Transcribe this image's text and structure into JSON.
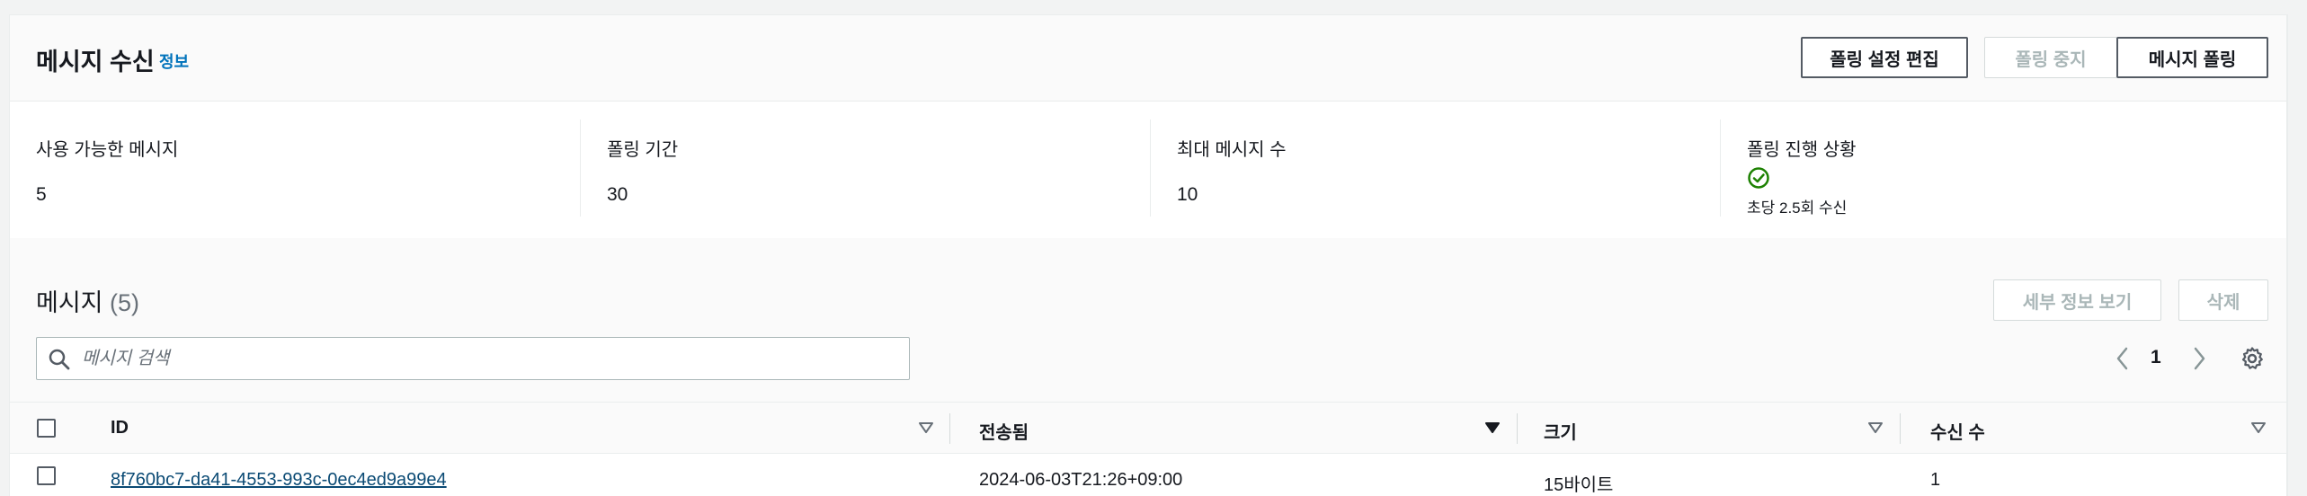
{
  "header": {
    "title": "메시지 수신",
    "info_link": "정보",
    "buttons": {
      "edit_polling": "폴링 설정 편집",
      "stop_polling": "폴링 중지",
      "poll_messages": "메시지 폴링"
    }
  },
  "stats": {
    "available_messages": {
      "label": "사용 가능한 메시지",
      "value": "5"
    },
    "polling_duration": {
      "label": "폴링 기간",
      "value": "30"
    },
    "max_messages": {
      "label": "최대 메시지 수",
      "value": "10"
    },
    "polling_progress": {
      "label": "폴링 진행 상황",
      "status_icon": "check-circle-icon",
      "status_text": "초당 2.5회 수신"
    }
  },
  "messages": {
    "title": "메시지",
    "count": "(5)",
    "buttons": {
      "view_details": "세부 정보 보기",
      "delete": "삭제"
    },
    "search_placeholder": "메시지 검색",
    "pagination": {
      "current_page": "1"
    },
    "columns": [
      "ID",
      "전송됨",
      "크기",
      "수신 수"
    ],
    "rows": [
      {
        "id": "8f760bc7-da41-4553-993c-0ec4ed9a99e4",
        "sent": "2024-06-03T21:26+09:00",
        "size": "15바이트",
        "receive_count": "1"
      }
    ]
  },
  "colors": {
    "link": "#0073bb",
    "success": "#1d8102",
    "border": "#eaeded",
    "disabled_text": "#aab7b8"
  }
}
